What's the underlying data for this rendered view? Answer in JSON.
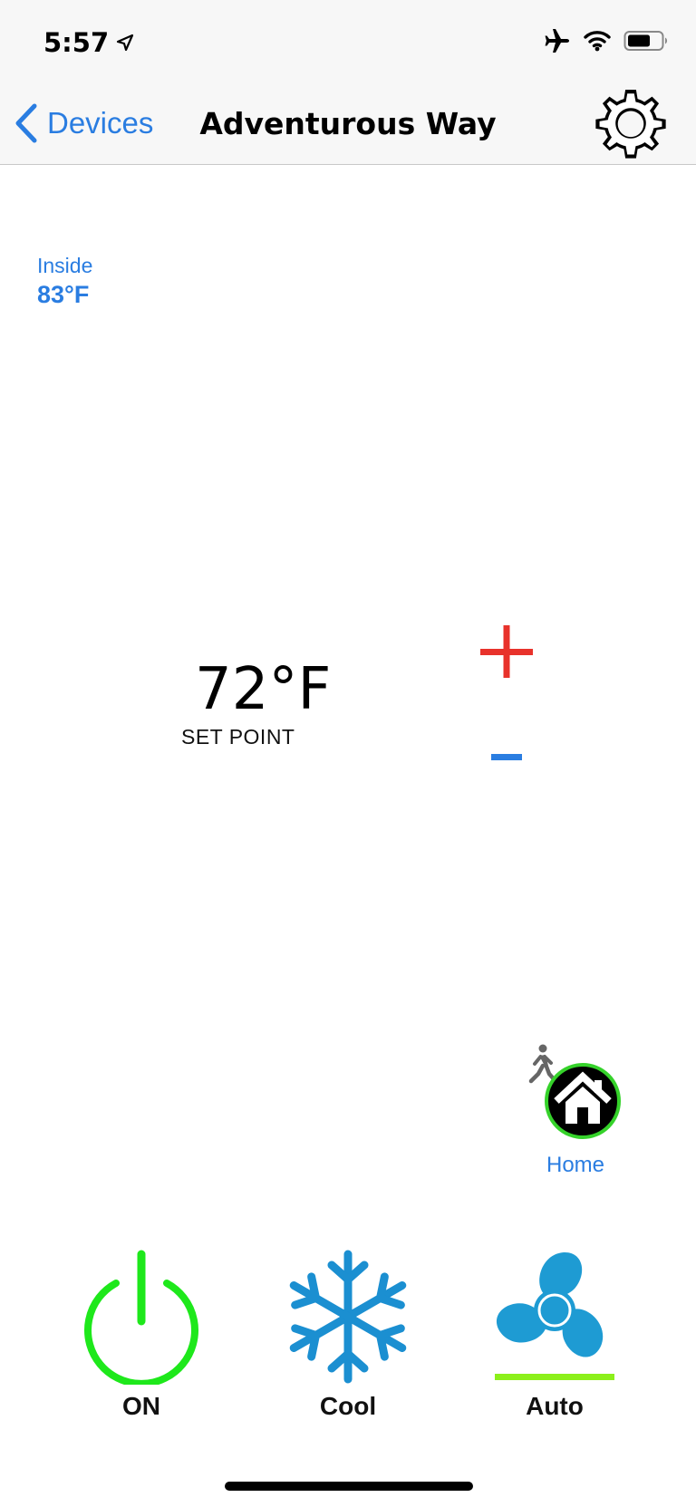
{
  "status_bar": {
    "time": "5:57",
    "icons": [
      "location-arrow-icon",
      "airplane-icon",
      "wifi-icon",
      "battery-icon"
    ]
  },
  "nav": {
    "back_label": "Devices",
    "title": "Adventurous Way",
    "settings_icon": "gear-icon"
  },
  "inside": {
    "label": "Inside",
    "value": "83°F"
  },
  "setpoint": {
    "value": "72°F",
    "label": "SET POINT"
  },
  "adjust": {
    "plus_icon": "plus-icon",
    "minus_icon": "minus-icon"
  },
  "occupancy": {
    "label": "Home",
    "icon": "house-icon"
  },
  "controls": [
    {
      "label": "ON",
      "icon": "power-icon"
    },
    {
      "label": "Cool",
      "icon": "snowflake-icon"
    },
    {
      "label": "Auto",
      "icon": "fan-icon"
    }
  ],
  "colors": {
    "accent_blue": "#2a7de1",
    "plus_red": "#e8322b",
    "power_green": "#1ee81b",
    "mode_blue": "#1b8fd1",
    "fan_blue": "#1e9bd3",
    "fan_underline": "#8cf01b",
    "home_ring": "#35d22a"
  }
}
